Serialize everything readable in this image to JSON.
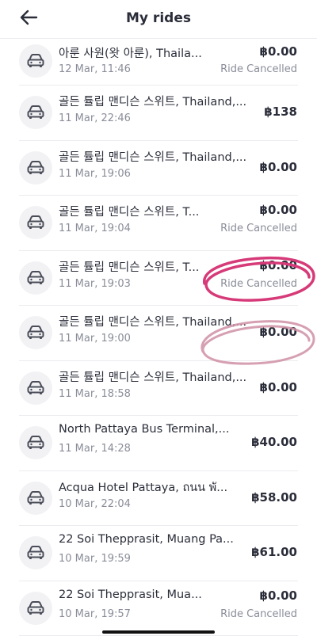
{
  "header": {
    "title": "My rides",
    "back_icon": "arrow-left-icon"
  },
  "rides": [
    {
      "name": "아룬 사원(왓 아룬), Thaila...",
      "time": "12 Mar, 11:46",
      "price": "฿0.00",
      "status": "Ride Cancelled",
      "icon": "car-icon"
    },
    {
      "name": "골든 튤립 맨디슨 스위트, Thailand,...",
      "time": "11 Mar, 22:46",
      "price": "฿138",
      "status": "",
      "icon": "car-icon"
    },
    {
      "name": "골든 튤립 맨디슨 스위트, Thailand,...",
      "time": "11 Mar, 19:06",
      "price": "฿0.00",
      "status": "",
      "icon": "car-icon"
    },
    {
      "name": "골든 튤립 맨디슨 스위트, T...",
      "time": "11 Mar, 19:04",
      "price": "฿0.00",
      "status": "Ride Cancelled",
      "icon": "car-icon"
    },
    {
      "name": "골든 튤립 맨디슨 스위트, T...",
      "time": "11 Mar, 19:03",
      "price": "฿0.00",
      "status": "Ride Cancelled",
      "icon": "car-icon"
    },
    {
      "name": "골든 튤립 맨디슨 스위트, Thailand,...",
      "time": "11 Mar, 19:00",
      "price": "฿0.00",
      "status": "",
      "icon": "car-icon"
    },
    {
      "name": "골든 튤립 맨디슨 스위트, Thailand,...",
      "time": "11 Mar, 18:58",
      "price": "฿0.00",
      "status": "",
      "icon": "car-icon"
    },
    {
      "name": "North Pattaya Bus Terminal,...",
      "time": "11 Mar, 14:28",
      "price": "฿40.00",
      "status": "",
      "icon": "car-icon"
    },
    {
      "name": "Acqua Hotel Pattaya, ถนน พั...",
      "time": "10 Mar, 22:04",
      "price": "฿58.00",
      "status": "",
      "icon": "car-icon"
    },
    {
      "name": "22 Soi Thepprasit, Muang Pa...",
      "time": "10 Mar, 19:59",
      "price": "฿61.00",
      "status": "",
      "icon": "car-icon"
    },
    {
      "name": "22 Soi Thepprasit, Mua...",
      "time": "10 Mar, 19:57",
      "price": "฿0.00",
      "status": "Ride Cancelled",
      "icon": "car-icon"
    }
  ],
  "colors": {
    "text": "#2b2e3a",
    "muted": "#8a8d99",
    "annotation_strong": "#d63a78",
    "annotation_faint": "#cf8fa5"
  }
}
